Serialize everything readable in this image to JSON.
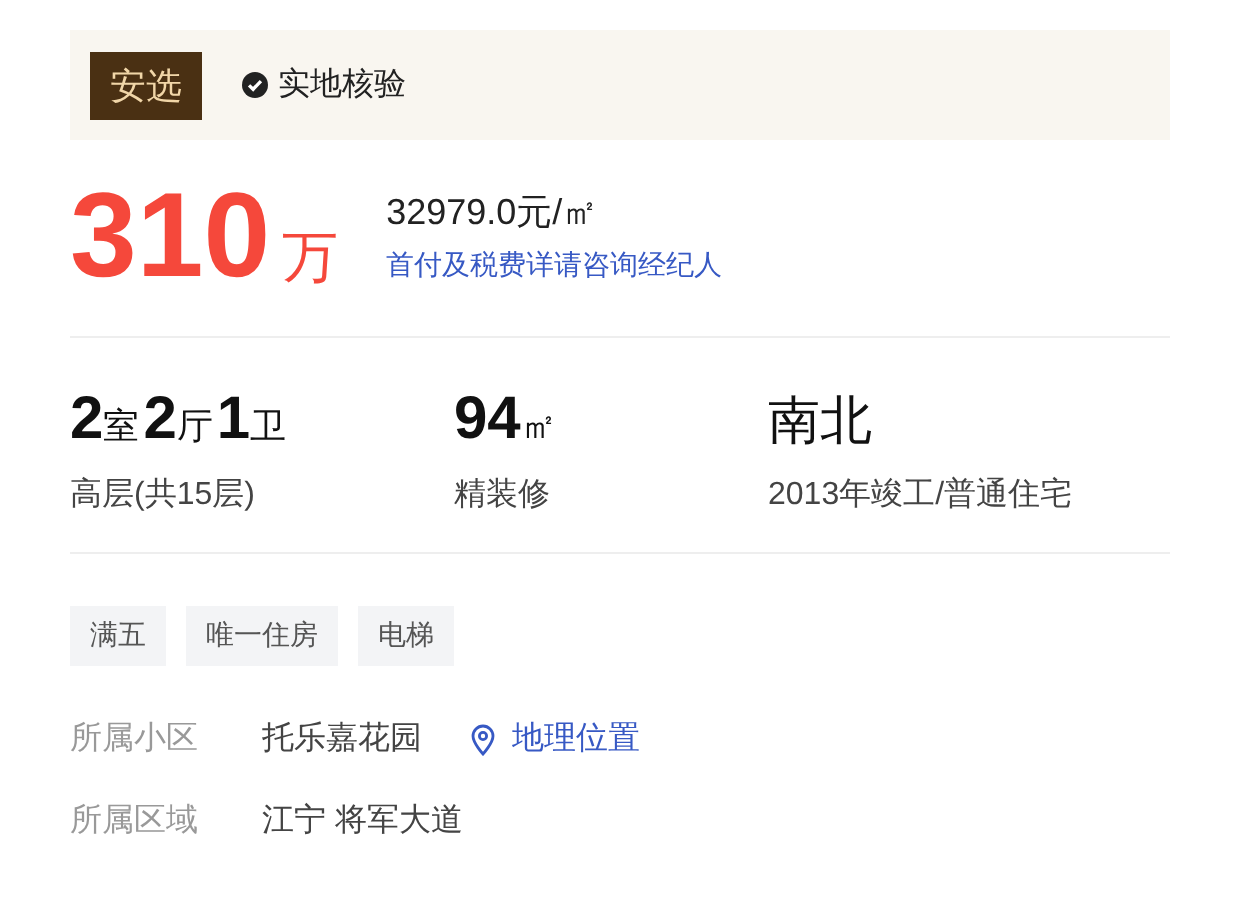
{
  "banner": {
    "badge": "安选",
    "verified": "实地核验"
  },
  "price": {
    "total": "310",
    "unit": "万",
    "unit_price": "32979.0元/㎡",
    "note": "首付及税费详请咨询经纪人"
  },
  "specs": [
    {
      "main_parts": [
        {
          "number": "2",
          "unit": "室"
        },
        {
          "number": "2",
          "unit": "厅"
        },
        {
          "number": "1",
          "unit": "卫"
        }
      ],
      "sub": "高层(共15层)"
    },
    {
      "main_parts": [
        {
          "number": "94",
          "unit": "㎡"
        }
      ],
      "sub": "精装修"
    },
    {
      "main_text": "南北",
      "sub": "2013年竣工/普通住宅"
    }
  ],
  "tags": [
    "满五",
    "唯一住房",
    "电梯"
  ],
  "info_rows": [
    {
      "label": "所属小区",
      "value": "托乐嘉花园",
      "link": "地理位置"
    },
    {
      "label": "所属区域",
      "value": "江宁 将军大道"
    }
  ]
}
